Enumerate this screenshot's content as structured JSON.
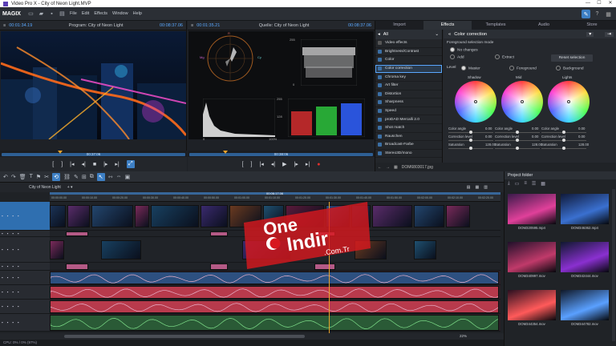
{
  "window": {
    "title": "Video Pro X - City of Neon Light.MVP",
    "controls": [
      "—",
      "☐",
      "✕"
    ]
  },
  "menubar": {
    "logo": "MAGIX",
    "items": [
      "File",
      "Edit",
      "Effects",
      "Window",
      "Help"
    ]
  },
  "program_monitor": {
    "timecode_left": "00:01:34.19",
    "title": "Program: City of Neon Light",
    "timecode_right": "00:08:37.06",
    "scrub_time": "00:37:06"
  },
  "source_monitor": {
    "timecode_left": "00:01:35.21",
    "title": "Quelle: City of Neon Light",
    "timecode_right": "00:08:37.06",
    "scrub_time": "00:38:06"
  },
  "scope_labels": {
    "vs_top": "R",
    "vs_left": "Mg",
    "vs_right": "Cy",
    "hist_max": "255",
    "hist_mid": "128",
    "hist_min": "0",
    "hist_pct": "100%",
    "wave_max": "255",
    "wave_min": "0"
  },
  "effects_panel": {
    "tabs": [
      "Import",
      "Effects",
      "Templates",
      "Audio",
      "Store"
    ],
    "active_tab": "Effects",
    "list_header": "All",
    "items": [
      "Video effects",
      "Brightness/Contrast",
      "Color",
      "Color correction",
      "Chroma key",
      "Art filter",
      "Distortion",
      "Sharpness",
      "Speed",
      "proDAD Mercalli 2.0",
      "Shot match",
      "Rauschen",
      "Broadcast-Farbe",
      "Stereo3D/mono"
    ],
    "selected": "Color correction",
    "footer_file": "DOM6803017.jpg"
  },
  "color_correction": {
    "title": "Color correction",
    "mode_label": "Foreground selection mode",
    "no_changes": "No changes",
    "add": "Add",
    "extract": "Extract",
    "reset": "Reset selection",
    "level_label": "Level",
    "level_options": [
      "Master",
      "Foreground",
      "Background"
    ],
    "wheels": [
      "Shadow",
      "Mid",
      "Lights"
    ],
    "rows": [
      {
        "label": "Color angle",
        "value": "0.00"
      },
      {
        "label": "Correction level",
        "value": "0.00"
      },
      {
        "label": "Saturation",
        "value": "128.00"
      }
    ]
  },
  "timeline": {
    "tab_name": "City of Neon Light",
    "ruler_marks": [
      "00:00:00.00",
      "00:00:10.00",
      "00:00:20.00",
      "00:00:30.00",
      "00:00:40.00",
      "00:00:50.00",
      "00:01:00.00",
      "00:01:10.00",
      "00:01:20.00",
      "00:01:30.00",
      "00:01:40.00",
      "00:01:50.00",
      "00:02:00.00",
      "00:02:10.00",
      "00:02:20.00"
    ],
    "playhead": "00:06:17.06",
    "zoom": "22%"
  },
  "project_folder": {
    "title": "Project folder",
    "files": [
      "DOM320595.mp4",
      "DOM346362.mp4",
      "DOM340997.mov",
      "DOM342444.mov",
      "DOM344354.mov",
      "DOM344782.mov"
    ]
  },
  "status": {
    "text": "CPU: 0% / 0% (97%)"
  },
  "watermark": {
    "line1": "One",
    "line2": "Indir",
    "line3": ".Com.Tr"
  },
  "colors": {
    "accent": "#3d7fc4",
    "timecode": "#5aa8ff",
    "record": "#e0302c",
    "audio_track": "#b83a4c",
    "watermark": "#e8222e"
  }
}
